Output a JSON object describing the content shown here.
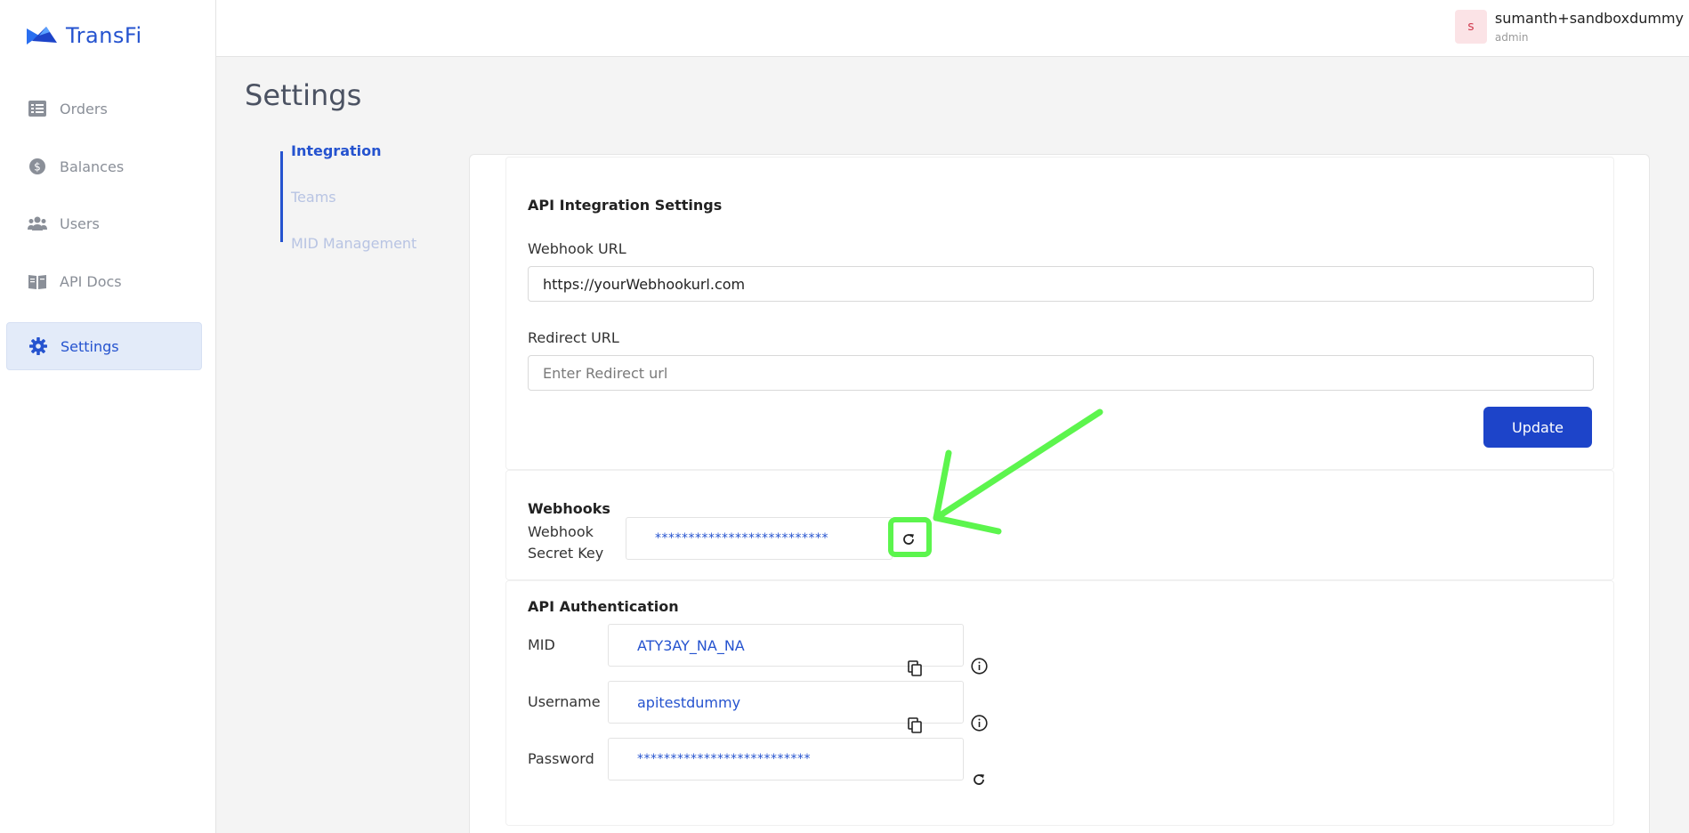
{
  "app": {
    "brand": "TransFi"
  },
  "sidebar": {
    "items": [
      {
        "label": "Orders",
        "icon": "list-icon",
        "active": false
      },
      {
        "label": "Balances",
        "icon": "dollar-coin-icon",
        "active": false
      },
      {
        "label": "Users",
        "icon": "users-icon",
        "active": false
      },
      {
        "label": "API Docs",
        "icon": "book-icon",
        "active": false
      },
      {
        "label": "Settings",
        "icon": "gear-icon",
        "active": true
      }
    ]
  },
  "header": {
    "avatar_letter": "s",
    "user_name": "sumanth+sandboxdummy",
    "user_role": "admin"
  },
  "page": {
    "title": "Settings"
  },
  "subnav": {
    "items": [
      {
        "label": "Integration",
        "active": true
      },
      {
        "label": "Teams",
        "active": false
      },
      {
        "label": "MID Management",
        "active": false
      }
    ]
  },
  "integration": {
    "title": "API Integration Settings",
    "webhook_label": "Webhook URL",
    "webhook_value": "https://yourWebhookurl.com",
    "redirect_label": "Redirect URL",
    "redirect_value": "",
    "redirect_placeholder": "Enter Redirect url",
    "update_label": "Update"
  },
  "webhooks": {
    "title": "Webhooks",
    "secret_label_line1": "Webhook",
    "secret_label_line2": "Secret Key",
    "secret_value": "**************************"
  },
  "auth": {
    "title": "API Authentication",
    "mid_label": "MID",
    "mid_value": "ATY3AY_NA_NA",
    "username_label": "Username",
    "username_value": "apitestdummy",
    "password_label": "Password",
    "password_value": "**************************"
  },
  "colors": {
    "accent": "#2553cf",
    "button": "#1d44c9",
    "annotation": "#5cf54d"
  }
}
